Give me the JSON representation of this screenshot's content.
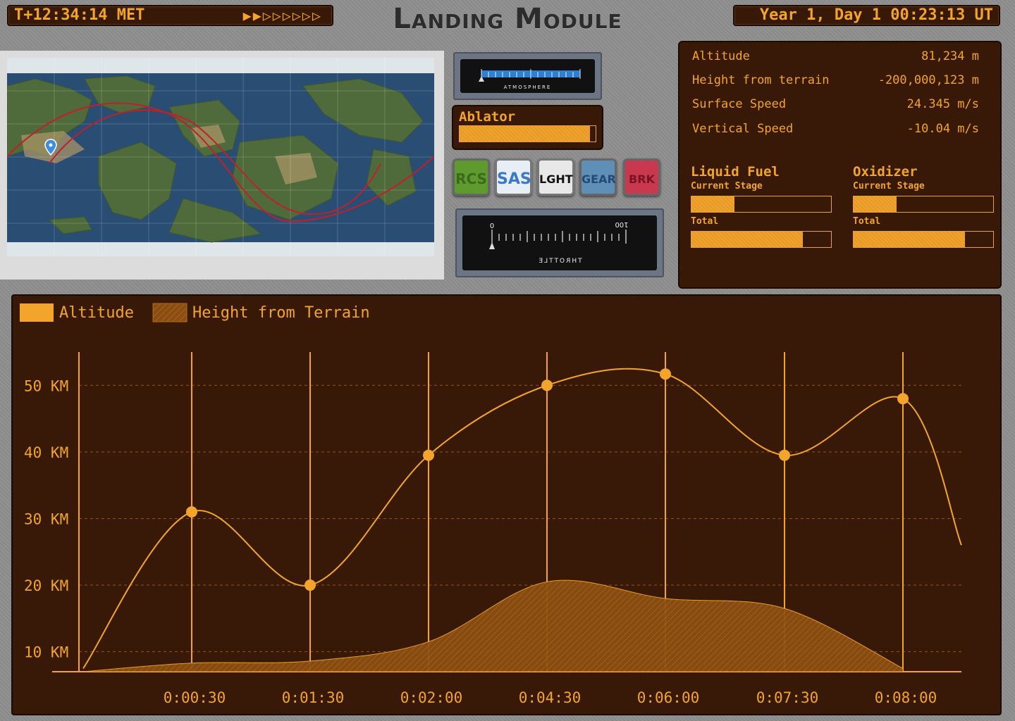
{
  "header": {
    "met": "T+12:34:14 MET",
    "warp_indicator": "▶▶▷▷▷▷▷▷",
    "title": "Landing Module",
    "ut": "Year 1, Day 1 00:23:13 UT"
  },
  "gauges": {
    "atmosphere_label": "ATMOSPHERE",
    "throttle_label": "THROTTLE",
    "throttle_min": "0",
    "throttle_max": "100"
  },
  "ablator": {
    "label": "Ablator",
    "level": 0.96
  },
  "actions": {
    "rcs": "RCS",
    "sas": "SAS",
    "lght": "LGHT",
    "gear": "GEAR",
    "brk": "BRK"
  },
  "stats": {
    "altitude_label": "Altitude",
    "altitude_value": "81,234 m",
    "height_label": "Height from terrain",
    "height_value": "-200,000,123 m",
    "surface_speed_label": "Surface Speed",
    "surface_speed_value": "24.345 m/s",
    "vertical_speed_label": "Vertical Speed",
    "vertical_speed_value": "-10.04 m/s"
  },
  "resources": {
    "liquid_fuel": {
      "title": "Liquid Fuel",
      "current_label": "Current Stage",
      "total_label": "Total",
      "current": 0.31,
      "total": 0.8
    },
    "oxidizer": {
      "title": "Oxidizer",
      "current_label": "Current Stage",
      "total_label": "Total",
      "current": 0.31,
      "total": 0.8
    }
  },
  "colors": {
    "accent": "#f3a52b",
    "panel": "#381907",
    "orbit": "#c0202b"
  },
  "chart_data": {
    "type": "area",
    "categories": [
      "0:00:30",
      "0:01:30",
      "0:02:00",
      "0:04:30",
      "0:06:00",
      "0:07:30",
      "0:08:00"
    ],
    "series": [
      {
        "name": "Altitude",
        "values": [
          31,
          20,
          39.5,
          50,
          51.7,
          39.5,
          48
        ]
      },
      {
        "name": "Height from Terrain",
        "values": [
          1.3,
          1.6,
          4.5,
          13.5,
          11,
          9.5,
          0.5
        ]
      }
    ],
    "y_ticks": [
      "10 KM",
      "20 KM",
      "30 KM",
      "40 KM",
      "50 KM"
    ],
    "ylim": [
      7,
      55
    ],
    "grid": "horizontal dashed",
    "legend": "top-left"
  }
}
